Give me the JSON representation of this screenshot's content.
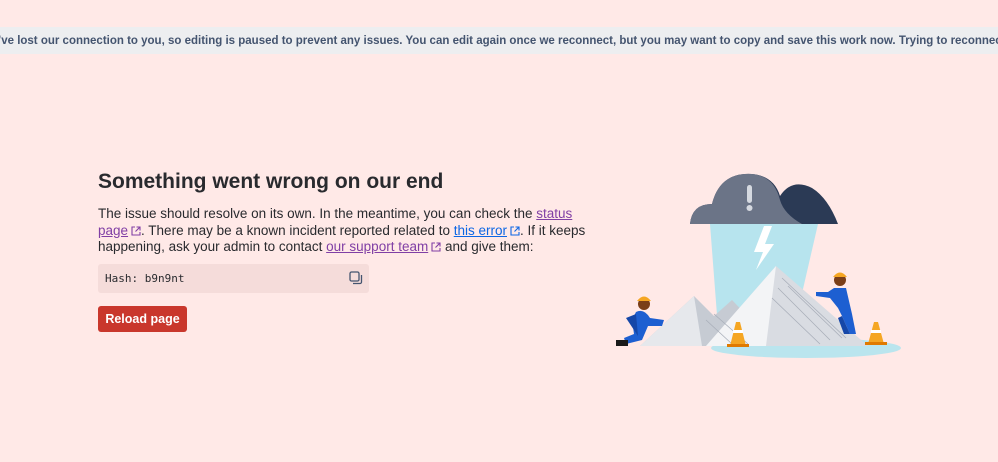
{
  "banner": {
    "text": "We’ve lost our connection to you, so editing is paused to prevent any issues. You can edit again once we reconnect, but you may want to copy and save this work now. Trying to reconnect…"
  },
  "error": {
    "title": "Something went wrong on our end",
    "text1": "The issue should resolve on its own. In the meantime, you can check the ",
    "status_link": "status page",
    "text2": ". There may be a known incident reported related to ",
    "error_link": "this error",
    "text3": ". If it keeps happening, ask your admin to contact ",
    "support_link": "our support team",
    "text4": " and give them:",
    "hash": "Hash: b9n9nt",
    "reload_label": "Reload page"
  },
  "colors": {
    "background": "#FFE9E7",
    "banner_bg": "#EDEEF0",
    "button": "#C9372C",
    "visited_link": "#803FA5",
    "link": "#0C66E4"
  },
  "icons": {
    "copy": "copy-icon",
    "external": "external-link-icon"
  }
}
